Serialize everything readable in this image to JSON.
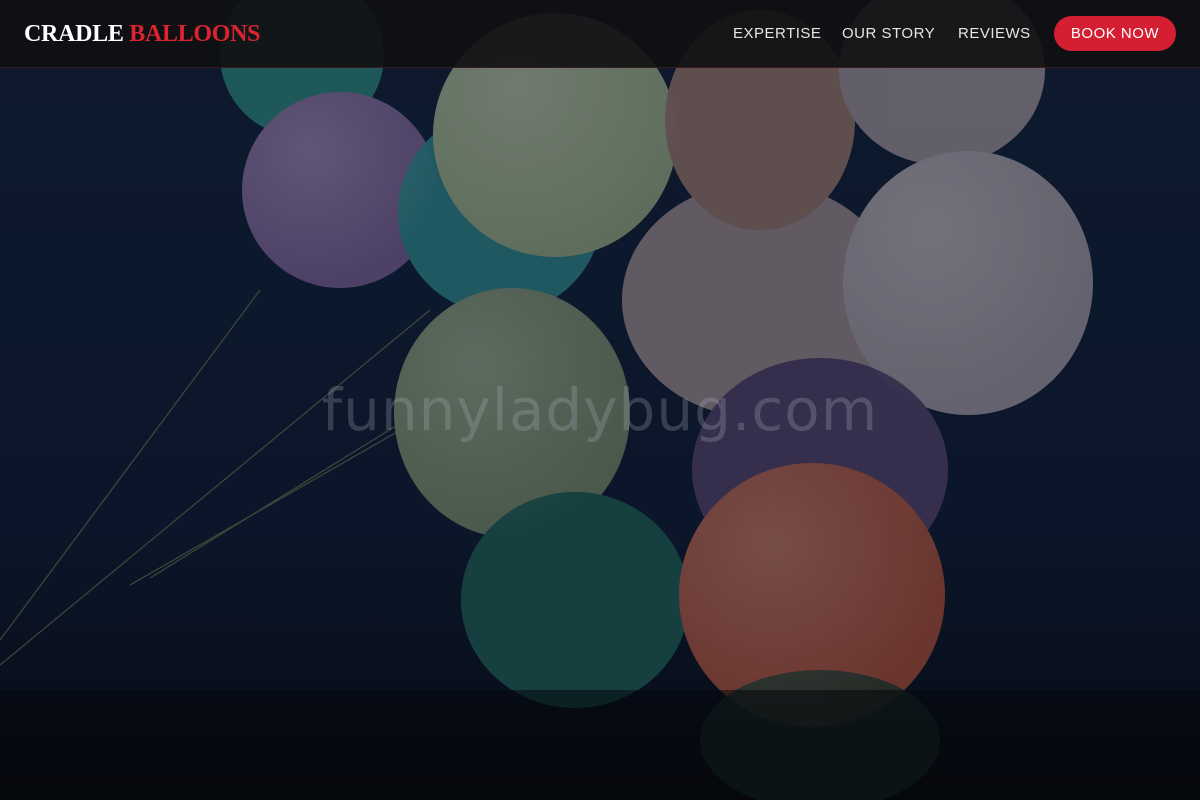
{
  "brand": {
    "part1": "CRADLE",
    "part2": "BALLOONS"
  },
  "nav": {
    "links": [
      "EXPERTISE",
      "OUR STORY",
      "REVIEWS"
    ],
    "cta_label": "BOOK NOW"
  },
  "hero": {
    "watermark": "funnyladybug.com",
    "image_subject": "balloons"
  },
  "colors": {
    "accent": "#d41f32",
    "logo_accent": "#dc2430",
    "navbar_bg": "#101012",
    "hero_sky": "#0d1a30"
  }
}
